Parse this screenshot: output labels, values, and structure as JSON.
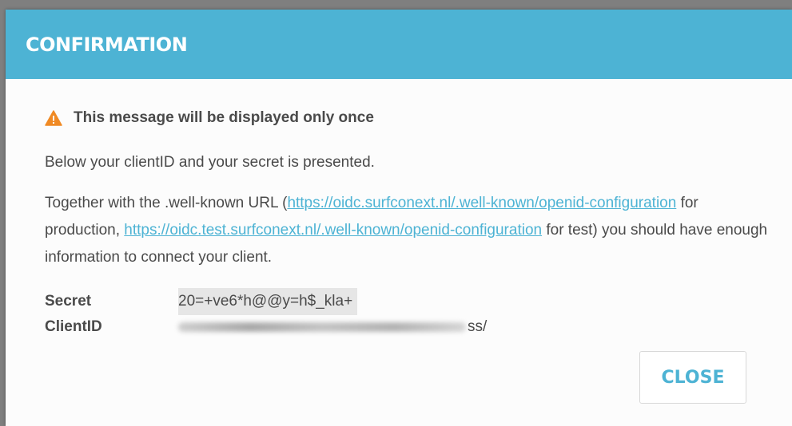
{
  "modal": {
    "title": "CONFIRMATION",
    "header_color": "#4db3d4"
  },
  "warning": {
    "icon": "warning-triangle-icon",
    "text": "This message will be displayed only once"
  },
  "intro": "Below your clientID and your secret is presented.",
  "info": {
    "before": "Together with the .well-known URL (",
    "prod_link": "https://oidc.surfconext.nl/.well-known/openid-configuration",
    "middle": " for production, ",
    "test_link": "https://oidc.test.surfconext.nl/.well-known/openid-configuration",
    "after": " for test) you should have enough information to connect your client."
  },
  "details": {
    "secret_label": "Secret",
    "secret_value": "20=+ve6*h@@y=h$_kla+",
    "clientid_label": "ClientID",
    "clientid_visible_suffix": "ss/"
  },
  "close_button": "CLOSE",
  "colors": {
    "link": "#4db3d4",
    "warning": "#f08a24"
  }
}
